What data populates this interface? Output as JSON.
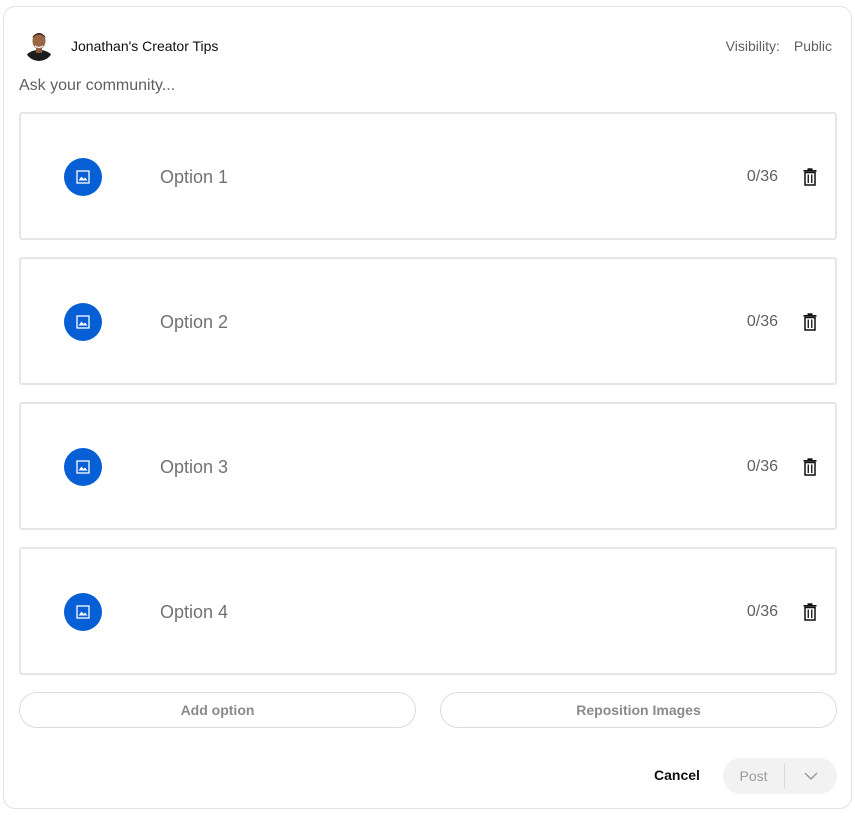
{
  "header": {
    "channel_name": "Jonathan's Creator Tips",
    "visibility_label": "Visibility:",
    "visibility_value": "Public"
  },
  "question": {
    "placeholder": "Ask your community..."
  },
  "options": [
    {
      "placeholder": "Option 1",
      "char_count": "0/36"
    },
    {
      "placeholder": "Option 2",
      "char_count": "0/36"
    },
    {
      "placeholder": "Option 3",
      "char_count": "0/36"
    },
    {
      "placeholder": "Option 4",
      "char_count": "0/36"
    }
  ],
  "actions": {
    "add_option": "Add option",
    "reposition_images": "Reposition Images",
    "cancel": "Cancel",
    "post": "Post"
  },
  "icons": {
    "option_image": "image-icon",
    "option_delete": "trash-icon",
    "post_dropdown": "chevron-down-icon"
  },
  "colors": {
    "accent": "#065fd4",
    "disabled_bg": "#f2f2f2"
  }
}
